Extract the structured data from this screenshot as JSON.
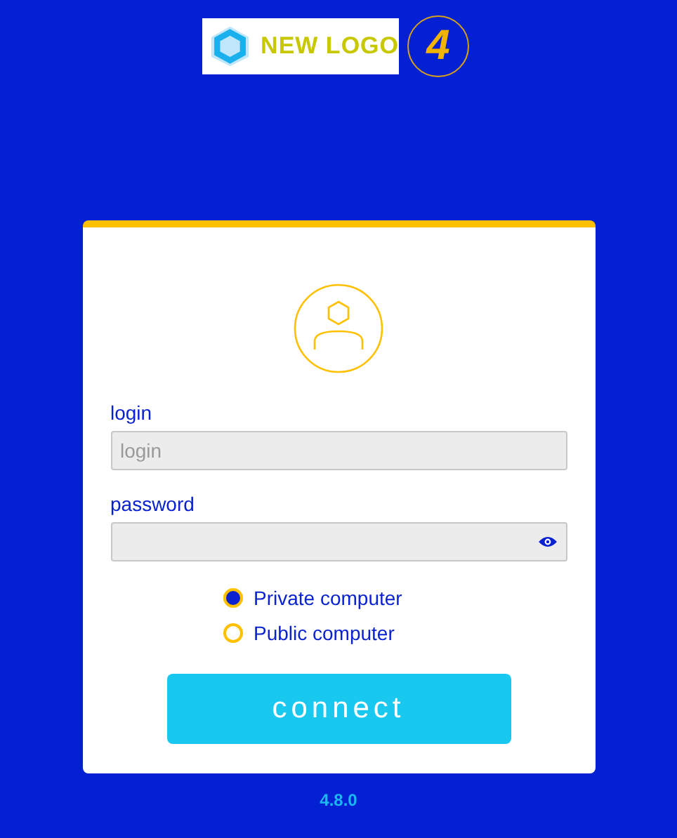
{
  "header": {
    "logo_text": "NEW LOGO",
    "badge_text": "4"
  },
  "form": {
    "login_label": "login",
    "login_placeholder": "login",
    "password_label": "password",
    "password_visible": false,
    "options": [
      {
        "label": "Private computer",
        "selected": true
      },
      {
        "label": "Public computer",
        "selected": false
      }
    ],
    "submit": "connect"
  },
  "version": "4.8.0"
}
